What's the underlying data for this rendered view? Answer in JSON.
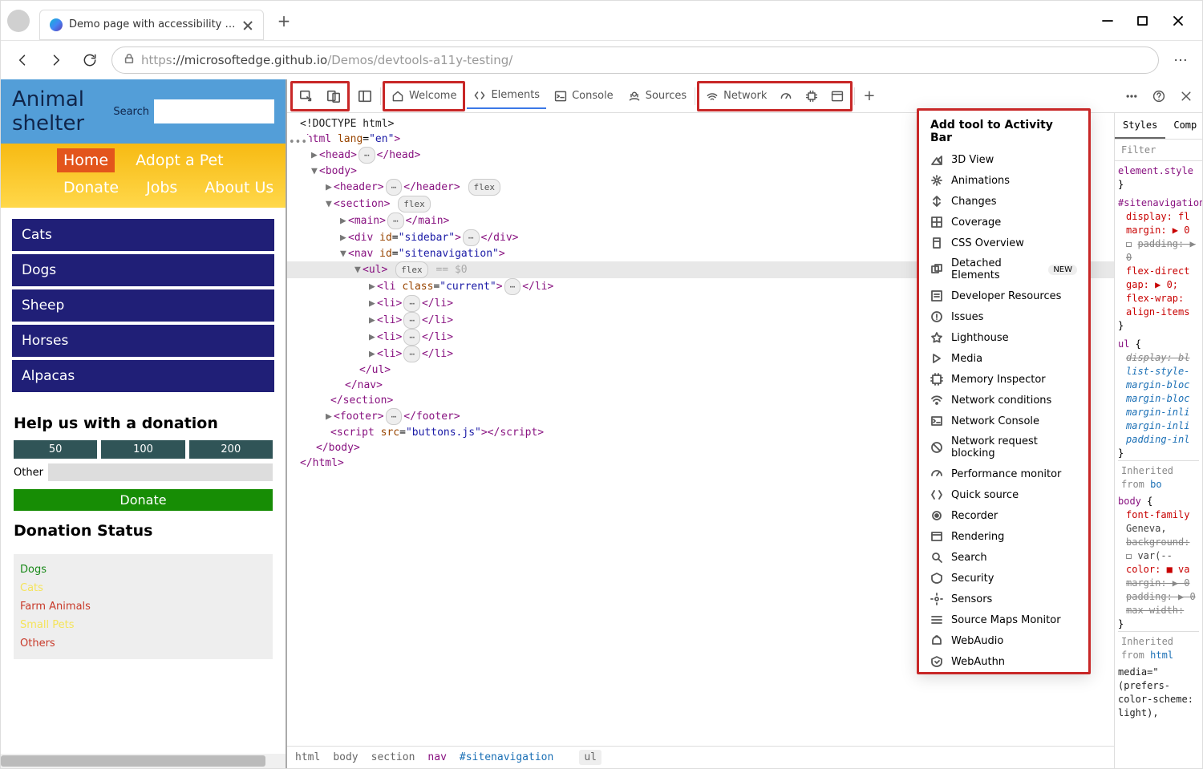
{
  "window": {
    "tabTitle": "Demo page with accessibility issu"
  },
  "url": {
    "protocol": "https",
    "host": "://microsoftedge.github.io",
    "path": "/Demos/devtools-a11y-testing/"
  },
  "page": {
    "title": "Animal shelter",
    "searchLabel": "Search",
    "nav": [
      "Home",
      "Adopt a Pet",
      "Donate",
      "Jobs",
      "About Us"
    ],
    "sidebar": [
      "Cats",
      "Dogs",
      "Sheep",
      "Horses",
      "Alpacas"
    ],
    "donation": {
      "heading": "Help us with a donation",
      "amounts": [
        "50",
        "100",
        "200"
      ],
      "otherLabel": "Other",
      "donateLabel": "Donate"
    },
    "status": {
      "heading": "Donation Status",
      "items": [
        {
          "label": "Dogs",
          "color": "#1b8a1b"
        },
        {
          "label": "Cats",
          "color": "#f5e45a"
        },
        {
          "label": "Farm Animals",
          "color": "#c83a2a"
        },
        {
          "label": "Small Pets",
          "color": "#f5e45a"
        },
        {
          "label": "Others",
          "color": "#c83a2a"
        }
      ]
    }
  },
  "devtools": {
    "tabs": {
      "welcome": "Welcome",
      "elements": "Elements",
      "console": "Console",
      "sources": "Sources",
      "network": "Network"
    },
    "addToolTitle": "Add tool to Activity Bar",
    "tools": [
      "3D View",
      "Animations",
      "Changes",
      "Coverage",
      "CSS Overview",
      "Detached Elements",
      "Developer Resources",
      "Issues",
      "Lighthouse",
      "Media",
      "Memory Inspector",
      "Network conditions",
      "Network Console",
      "Network request blocking",
      "Performance monitor",
      "Quick source",
      "Recorder",
      "Rendering",
      "Search",
      "Security",
      "Sensors",
      "Source Maps Monitor",
      "WebAudio",
      "WebAuthn"
    ],
    "newBadge": "NEW",
    "styleTabs": {
      "styles": "Styles",
      "computed": "Comp"
    },
    "filter": "Filter",
    "css": {
      "elst": "element.style",
      "siteNav": "#sitenavigation",
      "siteNavRules": [
        "display: fl",
        "margin: ▶ 0",
        "padding: ▶ 0",
        "flex-direct",
        "gap: ▶ 0;",
        "flex-wrap: ",
        "align-items"
      ],
      "ul": "ul",
      "ulRules": [
        "display: bl",
        "list-style-",
        "margin-bloc",
        "margin-bloc",
        "margin-inli",
        "margin-inli",
        "padding-inl"
      ],
      "inhFrom": "Inherited from",
      "body": "body",
      "bodyRules": [
        "font-family",
        "  Geneva,",
        "background:",
        "  var(--",
        "color: ■ va",
        "margin: ▶ 0",
        "padding: ▶ 0",
        "max-width: "
      ],
      "html": "html",
      "media": "media=\"(prefers-color-scheme: light),"
    },
    "crumbs": [
      "html",
      "body",
      "section",
      "nav",
      "#sitenavigation",
      "ul"
    ]
  }
}
